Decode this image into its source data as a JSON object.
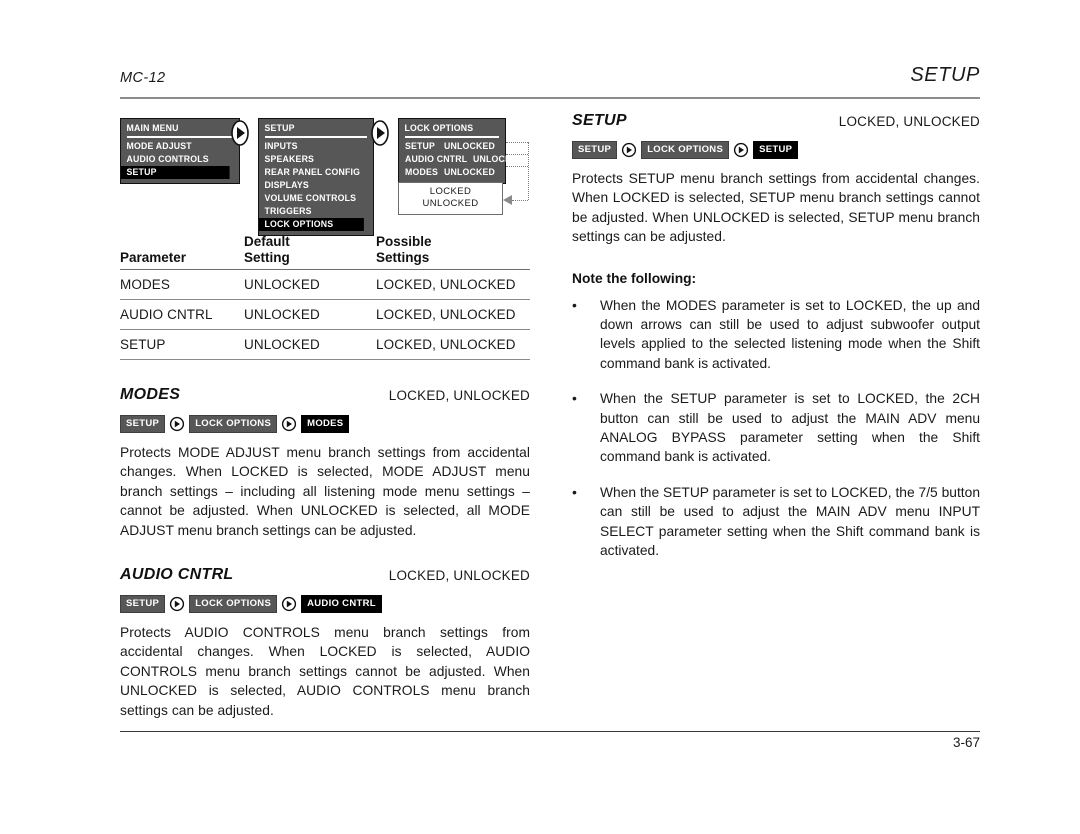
{
  "header": {
    "model": "MC-12",
    "section": "SETUP"
  },
  "footer": {
    "page_number": "3-67"
  },
  "diagram": {
    "main_menu": {
      "title": "MAIN MENU",
      "items": [
        "MODE ADJUST",
        "AUDIO CONTROLS",
        "SETUP"
      ],
      "selected": "SETUP"
    },
    "setup_menu": {
      "title": "SETUP",
      "items": [
        "INPUTS",
        "SPEAKERS",
        "REAR PANEL CONFIG",
        "DISPLAYS",
        "VOLUME CONTROLS",
        "TRIGGERS",
        "LOCK OPTIONS"
      ],
      "selected": "LOCK OPTIONS"
    },
    "lock_options_menu": {
      "title": "LOCK OPTIONS",
      "rows": [
        {
          "label": "SETUP",
          "value": "UNLOCKED"
        },
        {
          "label": "AUDIO CNTRL",
          "value": "UNLOCKED"
        },
        {
          "label": "MODES",
          "value": "UNLOCKED"
        }
      ]
    },
    "value_popup": {
      "options": [
        "LOCKED",
        "UNLOCKED"
      ]
    },
    "arrow_icon": "right-arrow-circle-icon"
  },
  "parameter_table": {
    "headers": {
      "parameter": "Parameter",
      "default_line1": "Default",
      "default_line2": "Setting",
      "possible_line1": "Possible",
      "possible_line2": "Settings"
    },
    "rows": [
      {
        "parameter": "MODES",
        "default": "UNLOCKED",
        "possible": "LOCKED, UNLOCKED"
      },
      {
        "parameter": "AUDIO CNTRL",
        "default": "UNLOCKED",
        "possible": "LOCKED, UNLOCKED"
      },
      {
        "parameter": "SETUP",
        "default": "UNLOCKED",
        "possible": "LOCKED, UNLOCKED"
      }
    ]
  },
  "sections": {
    "modes": {
      "title": "MODES",
      "values": "LOCKED, UNLOCKED",
      "breadcrumbs": [
        "SETUP",
        "LOCK OPTIONS",
        "MODES"
      ],
      "body": "Protects MODE ADJUST menu branch settings from accidental changes. When LOCKED is selected, MODE ADJUST menu branch settings – including all listening mode menu settings – cannot be adjusted. When UNLOCKED is selected, all MODE ADJUST menu branch settings can be adjusted."
    },
    "audio_cntrl": {
      "title": "AUDIO CNTRL",
      "values": "LOCKED, UNLOCKED",
      "breadcrumbs": [
        "SETUP",
        "LOCK OPTIONS",
        "AUDIO CNTRL"
      ],
      "body": "Protects AUDIO CONTROLS menu branch settings from accidental changes. When LOCKED is selected, AUDIO CONTROLS menu branch settings cannot be adjusted. When UNLOCKED is selected, AUDIO CONTROLS menu branch settings can be adjusted."
    },
    "setup": {
      "title": "SETUP",
      "values": "LOCKED, UNLOCKED",
      "breadcrumbs": [
        "SETUP",
        "LOCK OPTIONS",
        "SETUP"
      ],
      "body": "Protects SETUP menu branch settings from accidental changes. When LOCKED is selected, SETUP menu branch settings cannot be adjusted. When UNLOCKED is selected, SETUP menu branch settings can be adjusted.",
      "note_heading": "Note the following:",
      "note_bullet": "•",
      "notes": [
        "When the MODES parameter is set to LOCKED, the up and down arrows can still be used to adjust subwoofer output levels applied to the selected listening mode when the Shift command bank is activated.",
        "When the SETUP parameter is set to LOCKED, the 2CH button can still be used to adjust the MAIN ADV menu ANALOG BYPASS parameter setting when the Shift command bank is activated.",
        "When the SETUP parameter is set to LOCKED, the 7/5 button can still be used to adjust the MAIN ADV menu INPUT SELECT parameter setting when the Shift command bank is activated."
      ]
    }
  }
}
